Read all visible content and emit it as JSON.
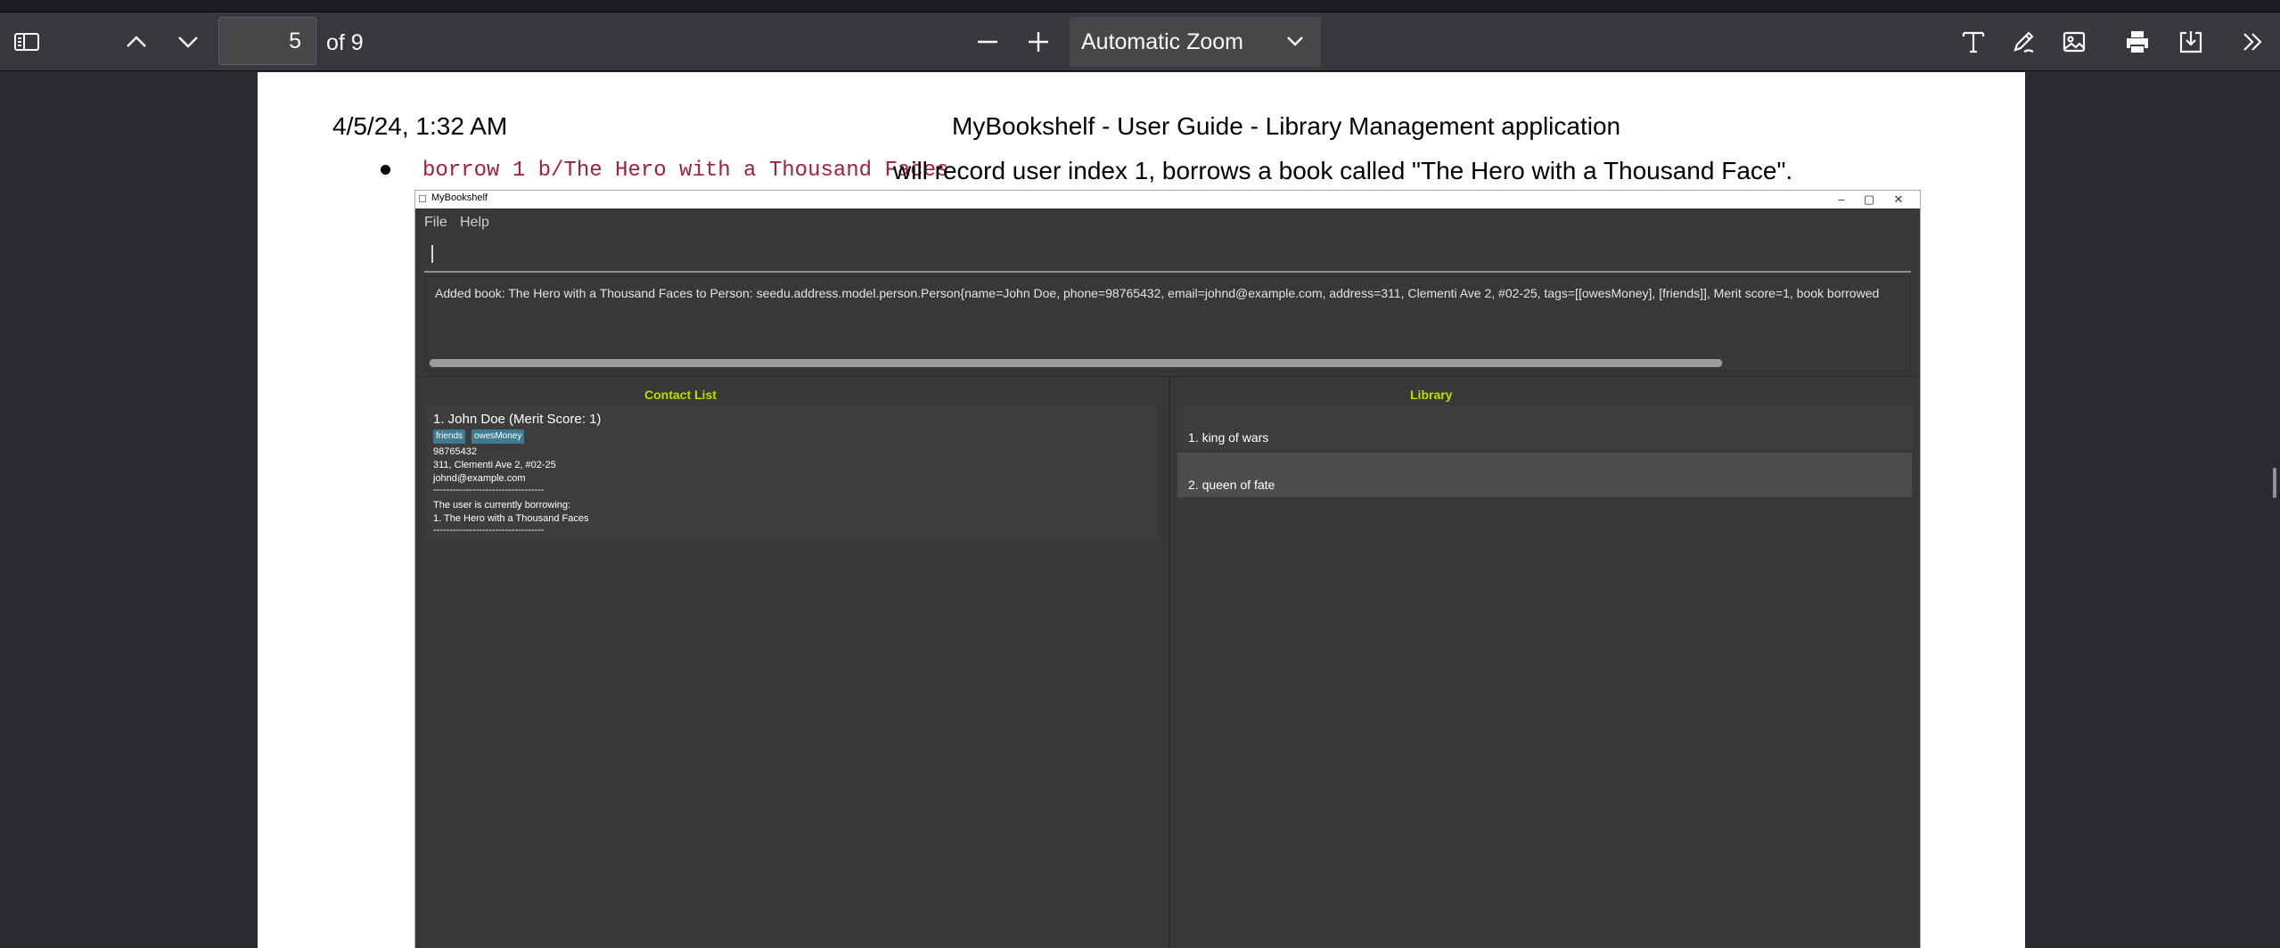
{
  "toolbar": {
    "sidebar_icon": "sidebar-toggle-icon",
    "page_number": "5",
    "page_count": "of 9",
    "zoom_value": "Automatic Zoom",
    "tools": [
      "text-tool-icon",
      "draw-tool-icon",
      "image-tool-icon",
      "print-icon",
      "save-icon",
      "more-tools-icon"
    ]
  },
  "pdf": {
    "header_date": "4/5/24, 1:32 AM",
    "header_title": "MyBookshelf - User Guide - Library Management application",
    "bullet_code": "borrow 1 b/The Hero with a Thousand Faces",
    "bullet_text": "will record user index 1, borrows a book called \"The Hero with a Thousand Face\"."
  },
  "app": {
    "window_title": "MyBookshelf",
    "menu": {
      "file": "File",
      "help": "Help"
    },
    "command_value": "",
    "result_text": "Added book: The Hero with a Thousand Faces to Person: seedu.address.model.person.Person{name=John Doe, phone=98765432, email=johnd@example.com, address=311, Clementi Ave 2, #02-25, tags=[[owesMoney], [friends]], Merit score=1, book borrowed",
    "contact_list_title": "Contact List",
    "library_title": "Library",
    "person": {
      "name": "1.  John Doe (Merit Score: 1)",
      "tags": [
        "friends",
        "owesMoney"
      ],
      "phone": "98765432",
      "address": "311, Clementi Ave 2, #02-25",
      "email": "johnd@example.com",
      "separator": "----------------------------------",
      "borrowing_label": "The user is currently borrowing:",
      "borrowed_book": "1. The Hero with a Thousand Faces"
    },
    "library": [
      "1. king of wars",
      "2. queen of fate"
    ]
  },
  "colors": {
    "toolbar_bg": "#38383d",
    "viewer_bg": "#2a2a2e",
    "code_text": "#a0213f",
    "app_bg": "#383838",
    "pane_title": "#b8e000",
    "tag_bg": "#3e7b91"
  }
}
